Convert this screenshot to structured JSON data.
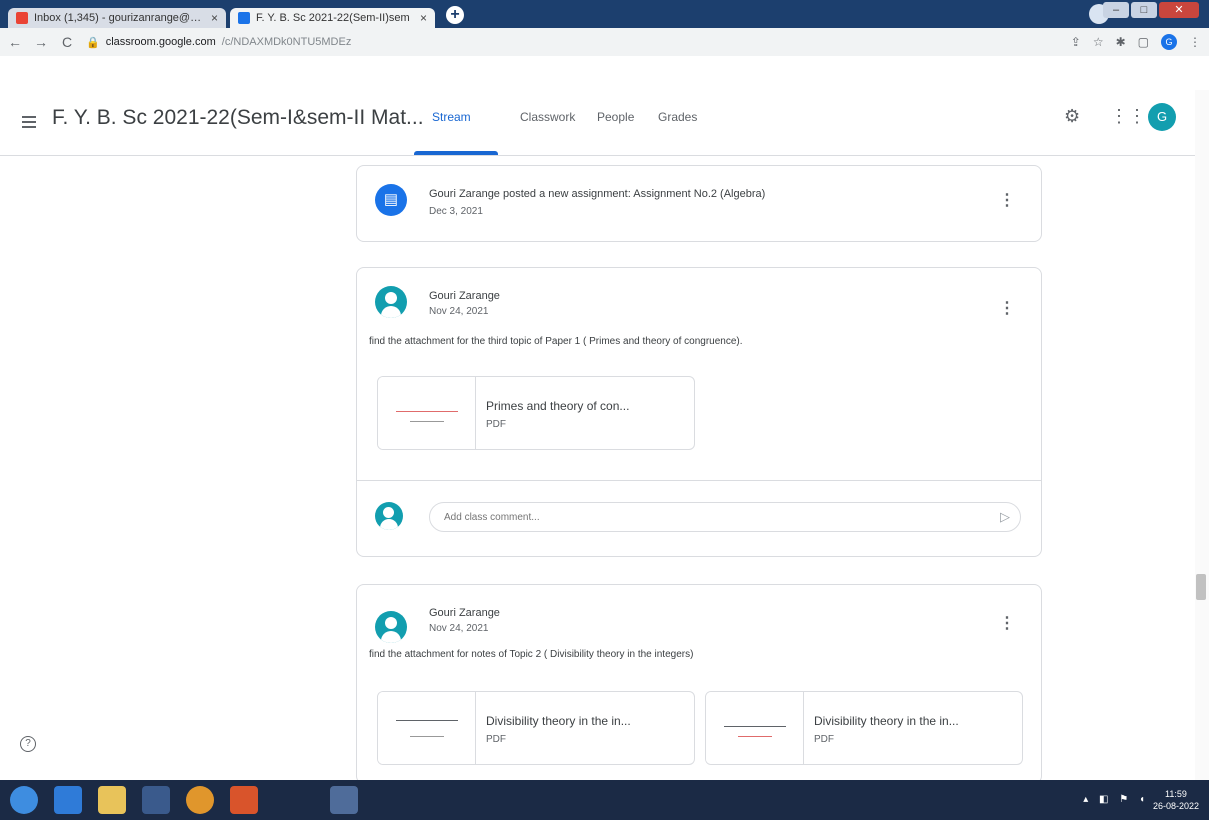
{
  "browser": {
    "tabs": [
      {
        "title": "Inbox (1,345) - gourizanrange@gm",
        "close": "×"
      },
      {
        "title": "F. Y. B. Sc 2021-22(Sem-II)sem",
        "close": "×"
      }
    ],
    "new_tab": "+",
    "nav": {
      "back": "←",
      "forward": "→",
      "reload": "C"
    },
    "url_host": "classroom.google.com",
    "url_path": "/c/NDAXMDk0NTU5MDEz",
    "profile_letter": "G"
  },
  "header": {
    "course_title": "F. Y. B. Sc 2021-22(Sem-I&sem-II Mat...",
    "tabs": [
      {
        "label": "Stream"
      },
      {
        "label": "Classwork"
      },
      {
        "label": "People"
      },
      {
        "label": "Grades"
      }
    ],
    "avatar_letter": "G"
  },
  "stream": {
    "assignment_post": {
      "text": "Gouri Zarange posted a new assignment: Assignment No.2 (Algebra)",
      "date": "Dec 3, 2021"
    },
    "post1": {
      "author": "Gouri Zarange",
      "date": "Nov 24, 2021",
      "text": "find the attachment for the third topic of Paper 1 ( Primes and theory of congruence).",
      "attachments": [
        {
          "name": "Primes and theory of con...",
          "type": "PDF"
        }
      ],
      "comment_placeholder": "Add class comment..."
    },
    "post2": {
      "author": "Gouri Zarange",
      "date": "Nov 24, 2021",
      "text": "find the attachment for notes of Topic 2 ( Divisibility theory in the integers)",
      "attachments": [
        {
          "name": "Divisibility theory in the in...",
          "type": "PDF"
        },
        {
          "name": "Divisibility theory in the in...",
          "type": "PDF"
        }
      ]
    }
  },
  "help": "?",
  "taskbar": {
    "time": "11:59",
    "date": "26-08-2022"
  }
}
